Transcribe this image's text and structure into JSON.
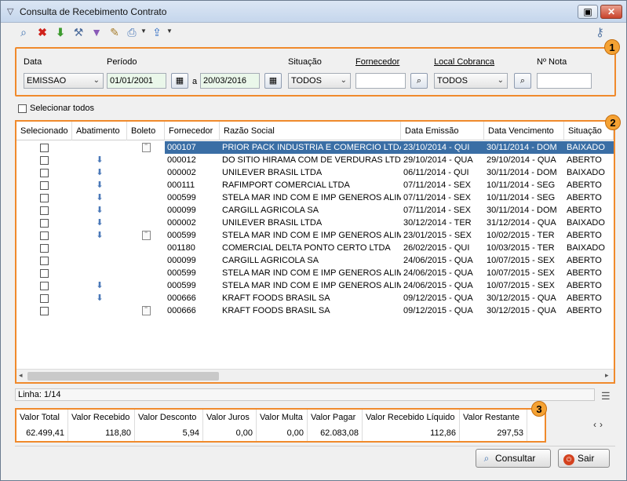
{
  "window": {
    "title": "Consulta de Recebimento Contrato"
  },
  "toolbar": {
    "icons": [
      "search-icon",
      "delete-icon",
      "download-icon",
      "tools-icon",
      "filter-icon",
      "edit-icon",
      "print-icon",
      "export-icon",
      "key-icon"
    ]
  },
  "filters": {
    "data_label": "Data",
    "data_value": "EMISSAO",
    "periodo_label": "Período",
    "periodo_start": "01/01/2001",
    "periodo_sep": "a",
    "periodo_end": "20/03/2016",
    "situacao_label": "Situação",
    "situacao_value": "TODOS",
    "fornecedor_label": "Fornecedor",
    "fornecedor_value": "",
    "local_label": "Local Cobranca",
    "local_value": "TODOS",
    "nota_label": "Nº Nota",
    "nota_value": ""
  },
  "badges": {
    "b1": "1",
    "b2": "2",
    "b3": "3"
  },
  "select_all": {
    "label": "Selecionar todos"
  },
  "grid": {
    "headers": [
      "Selecionado",
      "Abatimento",
      "Boleto",
      "Fornecedor",
      "Razão Social",
      "Data Emissão",
      "Data Vencimento",
      "Situação"
    ],
    "rows": [
      {
        "abat": false,
        "boleto": true,
        "forn": "000107",
        "razao": "PRIOR PACK INDUSTRIA E COMERCIO LTDA",
        "emissao": "23/10/2014 - QUI",
        "venc": "30/11/2014 - DOM",
        "sit": "BAIXADO"
      },
      {
        "abat": true,
        "boleto": false,
        "forn": "000012",
        "razao": "DO SITIO HIRAMA COM DE VERDURAS LTDA",
        "emissao": "29/10/2014 - QUA",
        "venc": "29/10/2014 - QUA",
        "sit": "ABERTO"
      },
      {
        "abat": true,
        "boleto": false,
        "forn": "000002",
        "razao": "UNILEVER BRASIL LTDA",
        "emissao": "06/11/2014 - QUI",
        "venc": "30/11/2014 - DOM",
        "sit": "BAIXADO"
      },
      {
        "abat": true,
        "boleto": false,
        "forn": "000111",
        "razao": "RAFIMPORT COMERCIAL LTDA",
        "emissao": "07/11/2014 - SEX",
        "venc": "10/11/2014 - SEG",
        "sit": "ABERTO"
      },
      {
        "abat": true,
        "boleto": false,
        "forn": "000599",
        "razao": "STELA MAR IND COM E IMP GENEROS ALIM L",
        "emissao": "07/11/2014 - SEX",
        "venc": "10/11/2014 - SEG",
        "sit": "ABERTO"
      },
      {
        "abat": true,
        "boleto": false,
        "forn": "000099",
        "razao": "CARGILL AGRICOLA SA",
        "emissao": "07/11/2014 - SEX",
        "venc": "30/11/2014 - DOM",
        "sit": "ABERTO"
      },
      {
        "abat": true,
        "boleto": false,
        "forn": "000002",
        "razao": "UNILEVER BRASIL LTDA",
        "emissao": "30/12/2014 - TER",
        "venc": "31/12/2014 - QUA",
        "sit": "BAIXADO"
      },
      {
        "abat": true,
        "boleto": true,
        "forn": "000599",
        "razao": "STELA MAR IND COM E IMP GENEROS ALIM L",
        "emissao": "23/01/2015 - SEX",
        "venc": "10/02/2015 - TER",
        "sit": "ABERTO"
      },
      {
        "abat": false,
        "boleto": false,
        "forn": "001180",
        "razao": "COMERCIAL DELTA PONTO CERTO LTDA",
        "emissao": "26/02/2015 - QUI",
        "venc": "10/03/2015 - TER",
        "sit": "BAIXADO"
      },
      {
        "abat": false,
        "boleto": false,
        "forn": "000099",
        "razao": "CARGILL AGRICOLA SA",
        "emissao": "24/06/2015 - QUA",
        "venc": "10/07/2015 - SEX",
        "sit": "ABERTO"
      },
      {
        "abat": false,
        "boleto": false,
        "forn": "000599",
        "razao": "STELA MAR IND COM E IMP GENEROS ALIM L",
        "emissao": "24/06/2015 - QUA",
        "venc": "10/07/2015 - SEX",
        "sit": "ABERTO"
      },
      {
        "abat": true,
        "boleto": false,
        "forn": "000599",
        "razao": "STELA MAR IND COM E IMP GENEROS ALIM L",
        "emissao": "24/06/2015 - QUA",
        "venc": "10/07/2015 - SEX",
        "sit": "ABERTO"
      },
      {
        "abat": true,
        "boleto": false,
        "forn": "000666",
        "razao": "KRAFT FOODS BRASIL SA",
        "emissao": "09/12/2015 - QUA",
        "venc": "30/12/2015 - QUA",
        "sit": "ABERTO"
      },
      {
        "abat": false,
        "boleto": true,
        "forn": "000666",
        "razao": "KRAFT FOODS BRASIL SA",
        "emissao": "09/12/2015 - QUA",
        "venc": "30/12/2015 - QUA",
        "sit": "ABERTO"
      }
    ]
  },
  "status": {
    "linha": "Linha: 1/14"
  },
  "totals": {
    "headers": [
      "Valor Total",
      "Valor Recebido",
      "Valor Desconto",
      "Valor Juros",
      "Valor Multa",
      "Valor Pagar",
      "Valor Recebido Líquido",
      "Valor Restante"
    ],
    "values": [
      "62.499,41",
      "118,80",
      "5,94",
      "0,00",
      "0,00",
      "62.083,08",
      "112,86",
      "297,53"
    ]
  },
  "buttons": {
    "consultar": "Consultar",
    "sair": "Sair"
  },
  "colors": {
    "highlight": "#f08a2c",
    "selection": "#3a6ea5"
  }
}
